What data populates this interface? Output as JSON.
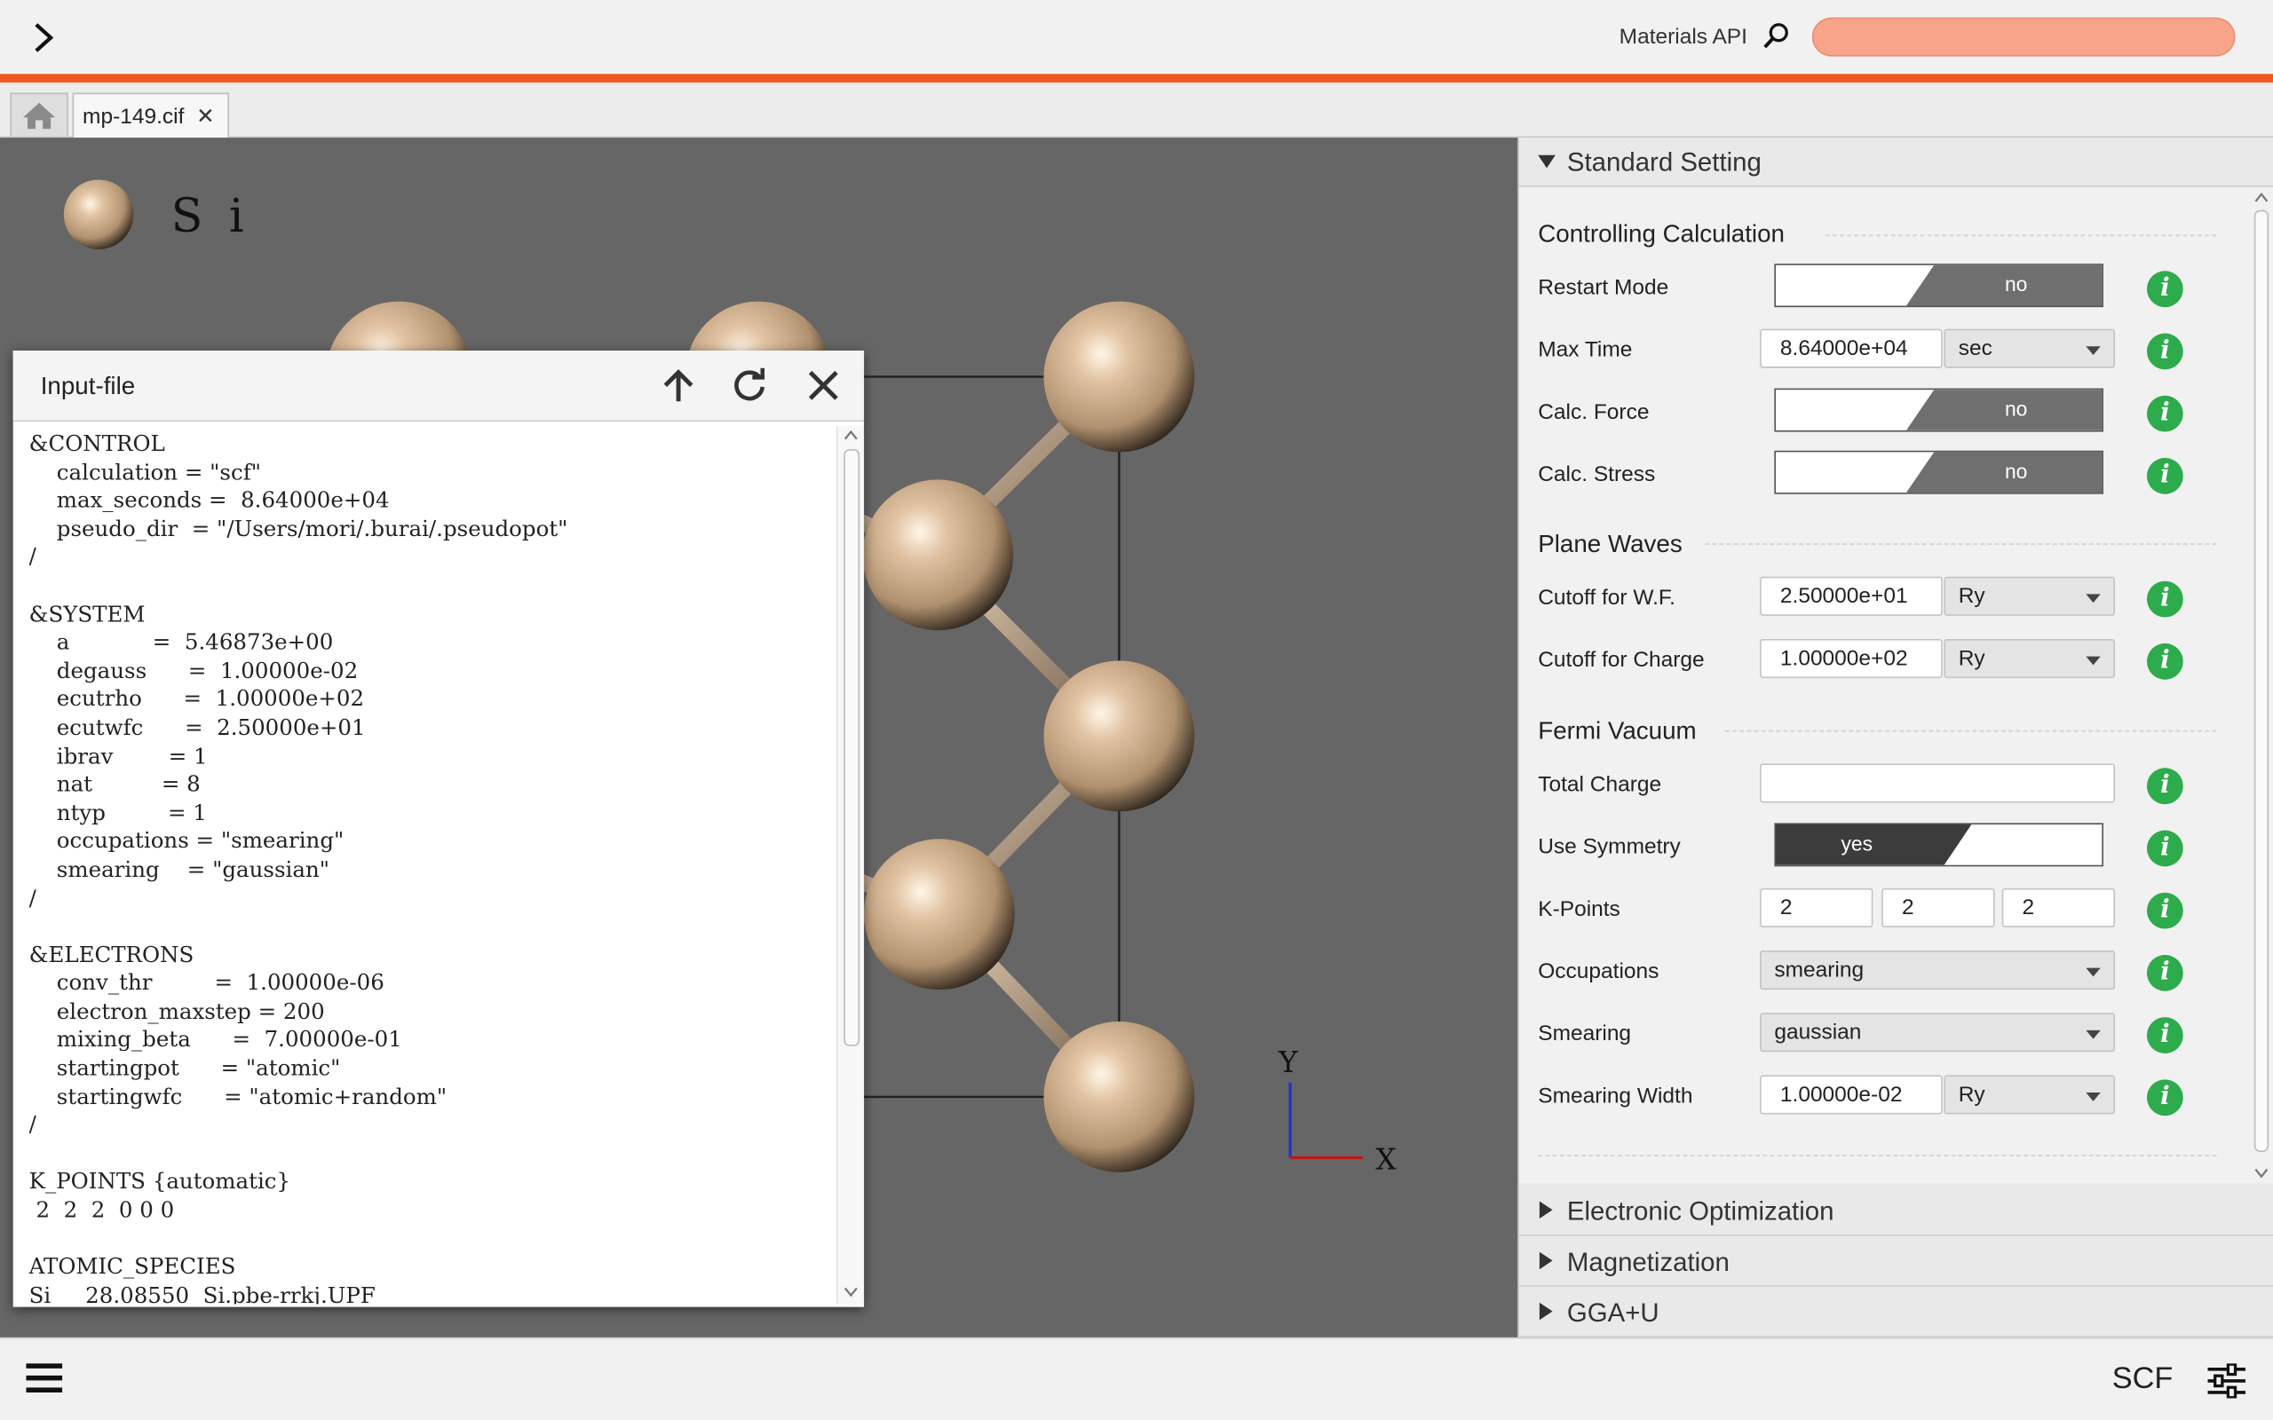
{
  "header": {
    "api_label": "Materials API",
    "search_placeholder": "",
    "accent_color": "#f05a22"
  },
  "tabs": {
    "home_icon": "home-icon",
    "file_tab_label": "mp-149.cif",
    "close_glyph": "✕"
  },
  "viewer": {
    "element_legend": "Si",
    "axis_x": "X",
    "axis_y": "Y"
  },
  "input_panel": {
    "title": "Input-file",
    "content": "&CONTROL\n    calculation = \"scf\"\n    max_seconds =  8.64000e+04\n    pseudo_dir  = \"/Users/mori/.burai/.pseudopot\"\n/\n\n&SYSTEM\n    a            =  5.46873e+00\n    degauss      =  1.00000e-02\n    ecutrho      =  1.00000e+02\n    ecutwfc      =  2.50000e+01\n    ibrav        = 1\n    nat          = 8\n    ntyp         = 1\n    occupations = \"smearing\"\n    smearing    = \"gaussian\"\n/\n\n&ELECTRONS\n    conv_thr         =  1.00000e-06\n    electron_maxstep = 200\n    mixing_beta      =  7.00000e-01\n    startingpot      = \"atomic\"\n    startingwfc      = \"atomic+random\"\n/\n\nK_POINTS {automatic}\n 2  2  2  0 0 0\n\nATOMIC_SPECIES\nSi     28.08550  Si.pbe-rrkj.UPF"
  },
  "settings": {
    "standard_title": "Standard Setting",
    "groups": {
      "controlling": "Controlling Calculation",
      "plane_waves": "Plane Waves",
      "fermi": "Fermi Vacuum"
    },
    "restart_mode": {
      "label": "Restart Mode",
      "value": "no"
    },
    "max_time": {
      "label": "Max Time",
      "value": "8.64000e+04",
      "unit": "sec"
    },
    "calc_force": {
      "label": "Calc. Force",
      "value": "no"
    },
    "calc_stress": {
      "label": "Calc. Stress",
      "value": "no"
    },
    "cutoff_wf": {
      "label": "Cutoff for W.F.",
      "value": "2.50000e+01",
      "unit": "Ry"
    },
    "cutoff_charge": {
      "label": "Cutoff for Charge",
      "value": "1.00000e+02",
      "unit": "Ry"
    },
    "total_charge": {
      "label": "Total Charge",
      "value": ""
    },
    "use_symmetry": {
      "label": "Use Symmetry",
      "value": "yes"
    },
    "kpoints": {
      "label": "K-Points",
      "values": [
        "2",
        "2",
        "2"
      ]
    },
    "occupations": {
      "label": "Occupations",
      "value": "smearing"
    },
    "smearing": {
      "label": "Smearing",
      "value": "gaussian"
    },
    "smearing_width": {
      "label": "Smearing Width",
      "value": "1.00000e-02",
      "unit": "Ry"
    },
    "info_glyph": "i",
    "collapsed_sections": [
      "Electronic Optimization",
      "Magnetization",
      "GGA+U"
    ]
  },
  "footer": {
    "calc_label": "SCF"
  }
}
